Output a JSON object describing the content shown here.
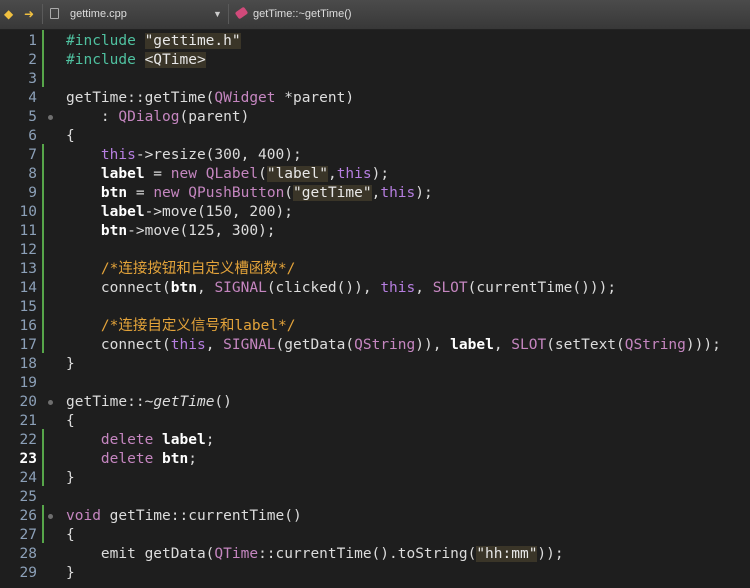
{
  "toolbar": {
    "back_label": "◆",
    "forward_label": "➜",
    "file_name": "gettime.cpp",
    "dropdown_glyph": "▼",
    "symbol_name": "getTime::~getTime()"
  },
  "colors": {
    "background": "#1e1e1e",
    "line_numbers": "#8ca0b8",
    "change_bar": "#57a64a",
    "comment": "#e3a33a",
    "preprocessor": "#4fc1a0",
    "keyword": "#c586c0"
  },
  "editor": {
    "current_line": "23",
    "lines": [
      {
        "num": "1"
      },
      {
        "num": "2"
      },
      {
        "num": "3"
      },
      {
        "num": "4"
      },
      {
        "num": "5"
      },
      {
        "num": "6"
      },
      {
        "num": "7"
      },
      {
        "num": "8"
      },
      {
        "num": "9"
      },
      {
        "num": "10"
      },
      {
        "num": "11"
      },
      {
        "num": "12"
      },
      {
        "num": "13"
      },
      {
        "num": "14"
      },
      {
        "num": "15"
      },
      {
        "num": "16"
      },
      {
        "num": "17"
      },
      {
        "num": "18"
      },
      {
        "num": "19"
      },
      {
        "num": "20"
      },
      {
        "num": "21"
      },
      {
        "num": "22"
      },
      {
        "num": "23"
      },
      {
        "num": "24"
      },
      {
        "num": "25"
      },
      {
        "num": "26"
      },
      {
        "num": "27"
      },
      {
        "num": "28"
      },
      {
        "num": "29"
      }
    ],
    "tokens": {
      "l1a": "#include ",
      "l1b": "\"gettime.h\"",
      "l2a": "#include ",
      "l2b": "<QTime>",
      "l4a": "getTime::getTime(",
      "l4b": "QWidget",
      "l4c": " *parent)",
      "l5a": "    : ",
      "l5b": "QDialog",
      "l5c": "(parent)",
      "l6": "{",
      "l7a": "    ",
      "l7b": "this",
      "l7c": "->resize(300, 400);",
      "l8a": "    ",
      "l8b": "label",
      "l8c": " = ",
      "l8d": "new",
      "l8e": " ",
      "l8f": "QLabel",
      "l8g": "(",
      "l8h": "\"label\"",
      "l8i": ",",
      "l8j": "this",
      "l8k": ");",
      "l9a": "    ",
      "l9b": "btn",
      "l9c": " = ",
      "l9d": "new",
      "l9e": " ",
      "l9f": "QPushButton",
      "l9g": "(",
      "l9h": "\"getTime\"",
      "l9i": ",",
      "l9j": "this",
      "l9k": ");",
      "l10a": "    ",
      "l10b": "label",
      "l10c": "->move(150, 200);",
      "l11a": "    ",
      "l11b": "btn",
      "l11c": "->move(125, 300);",
      "l13a": "    ",
      "l13b": "/*连接按钮和自定义槽函数*/",
      "l14a": "    connect(",
      "l14b": "btn",
      "l14c": ", ",
      "l14d": "SIGNAL",
      "l14e": "(clicked()), ",
      "l14f": "this",
      "l14g": ", ",
      "l14h": "SLOT",
      "l14i": "(currentTime()));",
      "l16a": "    ",
      "l16b": "/*连接自定义信号和label*/",
      "l17a": "    connect(",
      "l17b": "this",
      "l17c": ", ",
      "l17d": "SIGNAL",
      "l17e": "(getData(",
      "l17f": "QString",
      "l17g": ")), ",
      "l17h": "label",
      "l17i": ", ",
      "l17j": "SLOT",
      "l17k": "(setText(",
      "l17l": "QString",
      "l17m": ")));",
      "l18": "}",
      "l20a": "getTime::~",
      "l20b": "getTime",
      "l20c": "()",
      "l21": "{",
      "l22a": "    ",
      "l22b": "delete",
      "l22c": " ",
      "l22d": "label",
      "l22e": ";",
      "l23a": "    ",
      "l23b": "delete",
      "l23c": " ",
      "l23d": "btn",
      "l23e": ";",
      "l24": "}",
      "l26a": "void",
      "l26b": " getTime::currentTime()",
      "l27": "{",
      "l28a": "    emit getData(",
      "l28b": "QTime",
      "l28c": "::currentTime().toString(",
      "l28d": "\"hh:mm\"",
      "l28e": "));",
      "l29": "}"
    }
  }
}
